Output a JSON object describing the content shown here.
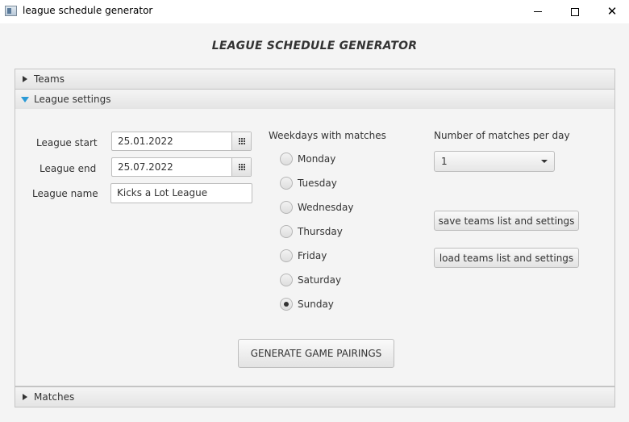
{
  "window": {
    "title": "league schedule generator",
    "minimize_icon": "minimize-icon",
    "maximize_icon": "maximize-icon",
    "close_icon": "close-icon",
    "close_glyph": "✕"
  },
  "heading": "LEAGUE SCHEDULE GENERATOR",
  "panes": {
    "teams": "Teams",
    "settings": "League settings",
    "matches": "Matches"
  },
  "settings": {
    "start_label": "League start",
    "start_value": "25.01.2022",
    "end_label": "League end",
    "end_value": "25.07.2022",
    "name_label": "League name",
    "name_value": "Kicks a Lot League",
    "weekdays_label": "Weekdays with matches",
    "weekdays": [
      {
        "label": "Monday",
        "selected": false
      },
      {
        "label": "Tuesday",
        "selected": false
      },
      {
        "label": "Wednesday",
        "selected": false
      },
      {
        "label": "Thursday",
        "selected": false
      },
      {
        "label": "Friday",
        "selected": false
      },
      {
        "label": "Saturday",
        "selected": false
      },
      {
        "label": "Sunday",
        "selected": true
      }
    ],
    "matches_per_day_label": "Number of matches per day",
    "matches_per_day_value": "1",
    "save_button": "save teams list and settings",
    "load_button": "load teams list and settings",
    "generate_button": "GENERATE GAME PAIRINGS"
  },
  "colors": {
    "accent_arrow": "#2a9ad6",
    "background": "#f4f4f4"
  }
}
